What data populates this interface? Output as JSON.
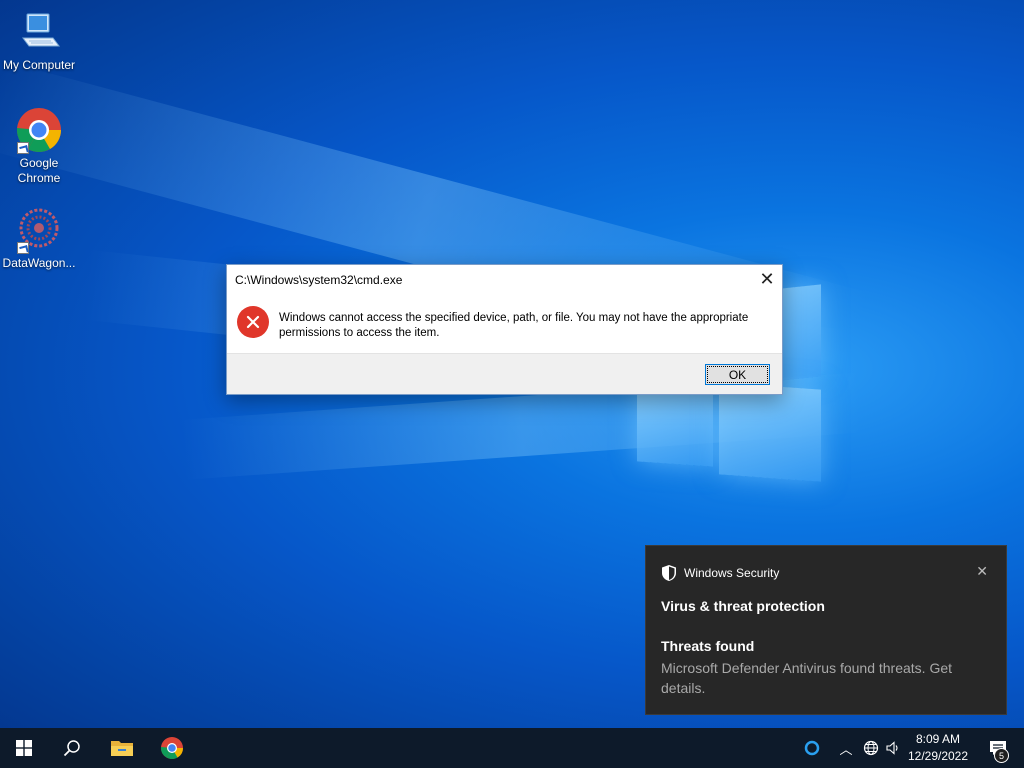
{
  "desktop": {
    "icons": [
      {
        "label": "My Computer",
        "icon": "computer-icon"
      },
      {
        "label": "Google\nChrome",
        "icon": "chrome-icon"
      },
      {
        "label": "DataWagon...",
        "icon": "datawagon-icon"
      }
    ]
  },
  "dialog": {
    "title": "C:\\Windows\\system32\\cmd.exe",
    "message": "Windows cannot access the specified device, path, or file. You may not have the appropriate permissions to access the item.",
    "ok_label": "OK",
    "icon": "error-icon"
  },
  "toast": {
    "app_name": "Windows Security",
    "heading": "Virus & threat protection",
    "title": "Threats found",
    "body": "Microsoft Defender Antivirus found threats. Get details."
  },
  "taskbar": {
    "time": "8:09 AM",
    "date": "12/29/2022",
    "notification_count": "5"
  },
  "colors": {
    "error_red": "#e0362a",
    "toast_bg": "#272727",
    "taskbar_bg": "#0d1a2a",
    "accent": "#0078d7"
  }
}
